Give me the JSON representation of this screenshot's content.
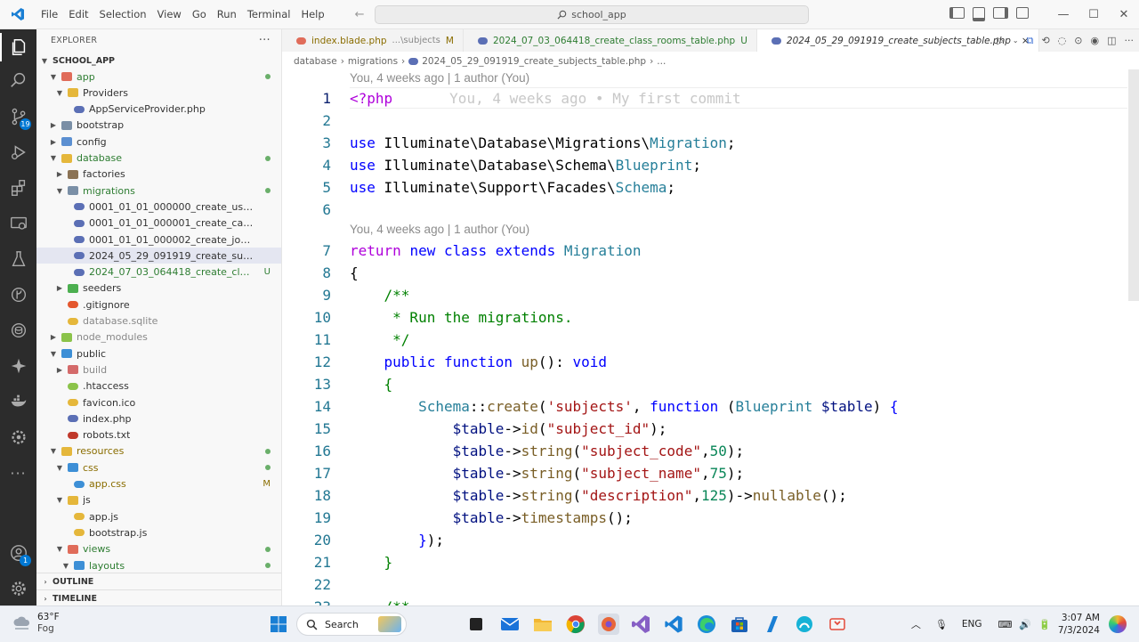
{
  "window": {
    "menu": [
      "File",
      "Edit",
      "Selection",
      "View",
      "Go",
      "Run",
      "Terminal",
      "Help"
    ],
    "search_text": "school_app"
  },
  "activity_bar": {
    "items": [
      "explorer-icon",
      "search-icon",
      "source-control-icon",
      "run-debug-icon",
      "extensions-icon",
      "remote-explorer-icon",
      "testing-icon",
      "git-graph-icon",
      "database-icon",
      "copilot-icon",
      "docker-icon",
      "settings-sync-icon",
      "more-icon",
      "accounts-icon",
      "manage-gear-icon"
    ],
    "source_control_badge": "19",
    "accounts_badge": "1"
  },
  "sidebar": {
    "title": "EXPLORER",
    "more": "···",
    "root": "SCHOOL_APP",
    "tree": [
      {
        "label": "app",
        "depth": 1,
        "type": "folder",
        "open": true,
        "color": "green",
        "dot": true,
        "folder_color": "#e06c5a"
      },
      {
        "label": "Providers",
        "depth": 2,
        "type": "folder",
        "open": true,
        "color": "normal",
        "folder_color": "#e5b73b"
      },
      {
        "label": "AppServiceProvider.php",
        "depth": 3,
        "type": "php",
        "color": "normal"
      },
      {
        "label": "bootstrap",
        "depth": 1,
        "type": "folder",
        "open": false,
        "color": "normal",
        "folder_color": "#7a8fa6"
      },
      {
        "label": "config",
        "depth": 1,
        "type": "folder",
        "open": false,
        "color": "normal",
        "folder_color": "#5b8fd1"
      },
      {
        "label": "database",
        "depth": 1,
        "type": "folder",
        "open": true,
        "color": "green",
        "dot": true,
        "folder_color": "#e5b73b"
      },
      {
        "label": "factories",
        "depth": 2,
        "type": "folder",
        "open": false,
        "color": "normal",
        "folder_color": "#8b7355"
      },
      {
        "label": "migrations",
        "depth": 2,
        "type": "folder",
        "open": true,
        "color": "green",
        "dot": true,
        "folder_color": "#7a8fa6"
      },
      {
        "label": "0001_01_01_000000_create_users_table.php",
        "depth": 3,
        "type": "php",
        "color": "normal"
      },
      {
        "label": "0001_01_01_000001_create_cache_table.php",
        "depth": 3,
        "type": "php",
        "color": "normal"
      },
      {
        "label": "0001_01_01_000002_create_jobs_table.php",
        "depth": 3,
        "type": "php",
        "color": "normal"
      },
      {
        "label": "2024_05_29_091919_create_subjects_table....",
        "depth": 3,
        "type": "php",
        "color": "normal",
        "selected": true
      },
      {
        "label": "2024_07_03_064418_create_class_roo...",
        "depth": 3,
        "type": "php",
        "color": "green",
        "status": "U"
      },
      {
        "label": "seeders",
        "depth": 2,
        "type": "folder",
        "open": false,
        "color": "normal",
        "folder_color": "#4caf50"
      },
      {
        "label": ".gitignore",
        "depth": 2,
        "type": "git",
        "color": "normal"
      },
      {
        "label": "database.sqlite",
        "depth": 2,
        "type": "sqlite",
        "color": "gray"
      },
      {
        "label": "node_modules",
        "depth": 1,
        "type": "folder",
        "open": false,
        "color": "gray",
        "folder_color": "#8bc34a"
      },
      {
        "label": "public",
        "depth": 1,
        "type": "folder",
        "open": true,
        "color": "normal",
        "folder_color": "#3d8fd6"
      },
      {
        "label": "build",
        "depth": 2,
        "type": "folder",
        "open": false,
        "color": "gray",
        "folder_color": "#d46a6a"
      },
      {
        "label": ".htaccess",
        "depth": 2,
        "type": "htaccess",
        "color": "normal"
      },
      {
        "label": "favicon.ico",
        "depth": 2,
        "type": "ico",
        "color": "normal"
      },
      {
        "label": "index.php",
        "depth": 2,
        "type": "php",
        "color": "normal"
      },
      {
        "label": "robots.txt",
        "depth": 2,
        "type": "robots",
        "color": "normal"
      },
      {
        "label": "resources",
        "depth": 1,
        "type": "folder",
        "open": true,
        "color": "olive",
        "dot": true,
        "folder_color": "#e5b73b"
      },
      {
        "label": "css",
        "depth": 2,
        "type": "folder",
        "open": true,
        "color": "olive",
        "dot": true,
        "folder_color": "#3d8fd6"
      },
      {
        "label": "app.css",
        "depth": 3,
        "type": "css",
        "color": "olive",
        "status": "M"
      },
      {
        "label": "js",
        "depth": 2,
        "type": "folder",
        "open": true,
        "color": "normal",
        "folder_color": "#e5b73b"
      },
      {
        "label": "app.js",
        "depth": 3,
        "type": "js",
        "color": "normal"
      },
      {
        "label": "bootstrap.js",
        "depth": 3,
        "type": "js",
        "color": "normal"
      },
      {
        "label": "views",
        "depth": 2,
        "type": "folder",
        "open": true,
        "color": "green",
        "dot": true,
        "folder_color": "#e06c5a"
      },
      {
        "label": "layouts",
        "depth": 3,
        "type": "folder",
        "open": true,
        "color": "green",
        "dot": true,
        "folder_color": "#3d8fd6"
      }
    ],
    "outline": "OUTLINE",
    "timeline": "TIMELINE"
  },
  "tabs": [
    {
      "label": "index.blade.php",
      "detail": "...\\subjects",
      "status": "M",
      "icon": "blade",
      "active": false
    },
    {
      "label": "2024_07_03_064418_create_class_rooms_table.php",
      "detail": "",
      "status": "U",
      "icon": "php",
      "active": false
    },
    {
      "label": "2024_05_29_091919_create_subjects_table.php",
      "detail": "",
      "status": "",
      "icon": "php",
      "active": true,
      "close": "×"
    }
  ],
  "breadcrumb": [
    "database",
    "migrations",
    "2024_05_29_091919_create_subjects_table.php",
    "..."
  ],
  "editor": {
    "blame_1": "You, 4 weeks ago | 1 author (You)",
    "blame_2": "You, 4 weeks ago | 1 author (You)",
    "inline_blame": "You, 4 weeks ago • My first commit",
    "lines": [
      {
        "n": "1",
        "tokens": [
          [
            "kw2",
            "<?php"
          ]
        ]
      },
      {
        "n": "2",
        "tokens": []
      },
      {
        "n": "3",
        "tokens": [
          [
            "kw",
            "use "
          ],
          [
            "",
            "Illuminate\\Database\\Migrations\\"
          ],
          [
            "cls",
            "Migration"
          ],
          [
            "",
            ";"
          ]
        ]
      },
      {
        "n": "4",
        "tokens": [
          [
            "kw",
            "use "
          ],
          [
            "",
            "Illuminate\\Database\\Schema\\"
          ],
          [
            "cls",
            "Blueprint"
          ],
          [
            "",
            ";"
          ]
        ]
      },
      {
        "n": "5",
        "tokens": [
          [
            "kw",
            "use "
          ],
          [
            "",
            "Illuminate\\Support\\Facades\\"
          ],
          [
            "cls",
            "Schema"
          ],
          [
            "",
            ";"
          ]
        ]
      },
      {
        "n": "6",
        "tokens": []
      },
      {
        "n": "7",
        "tokens": [
          [
            "kw2",
            "return "
          ],
          [
            "kw",
            "new class extends "
          ],
          [
            "cls",
            "Migration"
          ]
        ]
      },
      {
        "n": "8",
        "tokens": [
          [
            "",
            "{"
          ]
        ]
      },
      {
        "n": "9",
        "tokens": [
          [
            "cmt",
            "    /**"
          ]
        ]
      },
      {
        "n": "10",
        "tokens": [
          [
            "cmt",
            "     * Run the migrations."
          ]
        ]
      },
      {
        "n": "11",
        "tokens": [
          [
            "cmt",
            "     */"
          ]
        ]
      },
      {
        "n": "12",
        "tokens": [
          [
            "kw",
            "    public function "
          ],
          [
            "fn",
            "up"
          ],
          [
            "",
            "(): "
          ],
          [
            "kw",
            "void"
          ]
        ]
      },
      {
        "n": "13",
        "tokens": [
          [
            "cmt",
            "    {"
          ]
        ]
      },
      {
        "n": "14",
        "tokens": [
          [
            "cls",
            "        Schema"
          ],
          [
            "",
            "::"
          ],
          [
            "fn",
            "create"
          ],
          [
            "",
            "("
          ],
          [
            "str",
            "'subjects'"
          ],
          [
            "",
            ", "
          ],
          [
            "kw",
            "function "
          ],
          [
            "",
            "("
          ],
          [
            "cls",
            "Blueprint "
          ],
          [
            "var",
            "$table"
          ],
          [
            "",
            ") "
          ],
          [
            "kw",
            "{"
          ]
        ]
      },
      {
        "n": "15",
        "tokens": [
          [
            "var",
            "            $table"
          ],
          [
            "",
            "->"
          ],
          [
            "fn",
            "id"
          ],
          [
            "",
            "("
          ],
          [
            "str",
            "\"subject_id\""
          ],
          [
            "",
            ");"
          ]
        ]
      },
      {
        "n": "16",
        "tokens": [
          [
            "var",
            "            $table"
          ],
          [
            "",
            "->"
          ],
          [
            "fn",
            "string"
          ],
          [
            "",
            "("
          ],
          [
            "str",
            "\"subject_code\""
          ],
          [
            "",
            ","
          ],
          [
            "num",
            "50"
          ],
          [
            "",
            ");"
          ]
        ]
      },
      {
        "n": "17",
        "tokens": [
          [
            "var",
            "            $table"
          ],
          [
            "",
            "->"
          ],
          [
            "fn",
            "string"
          ],
          [
            "",
            "("
          ],
          [
            "str",
            "\"subject_name\""
          ],
          [
            "",
            ","
          ],
          [
            "num",
            "75"
          ],
          [
            "",
            ");"
          ]
        ]
      },
      {
        "n": "18",
        "tokens": [
          [
            "var",
            "            $table"
          ],
          [
            "",
            "->"
          ],
          [
            "fn",
            "string"
          ],
          [
            "",
            "("
          ],
          [
            "str",
            "\"description\""
          ],
          [
            "",
            ","
          ],
          [
            "num",
            "125"
          ],
          [
            "",
            ")->"
          ],
          [
            "fn",
            "nullable"
          ],
          [
            "",
            "();"
          ]
        ]
      },
      {
        "n": "19",
        "tokens": [
          [
            "var",
            "            $table"
          ],
          [
            "",
            "->"
          ],
          [
            "fn",
            "timestamps"
          ],
          [
            "",
            "();"
          ]
        ]
      },
      {
        "n": "20",
        "tokens": [
          [
            "kw",
            "        }"
          ],
          [
            "",
            ");"
          ]
        ]
      },
      {
        "n": "21",
        "tokens": [
          [
            "cmt",
            "    }"
          ]
        ]
      },
      {
        "n": "22",
        "tokens": []
      },
      {
        "n": "23",
        "tokens": [
          [
            "cmt",
            "    /**"
          ]
        ]
      }
    ]
  },
  "taskbar": {
    "temperature": "63°F",
    "condition": "Fog",
    "search_label": "Search",
    "language": "ENG",
    "time": "3:07 AM",
    "date": "7/3/2024"
  }
}
